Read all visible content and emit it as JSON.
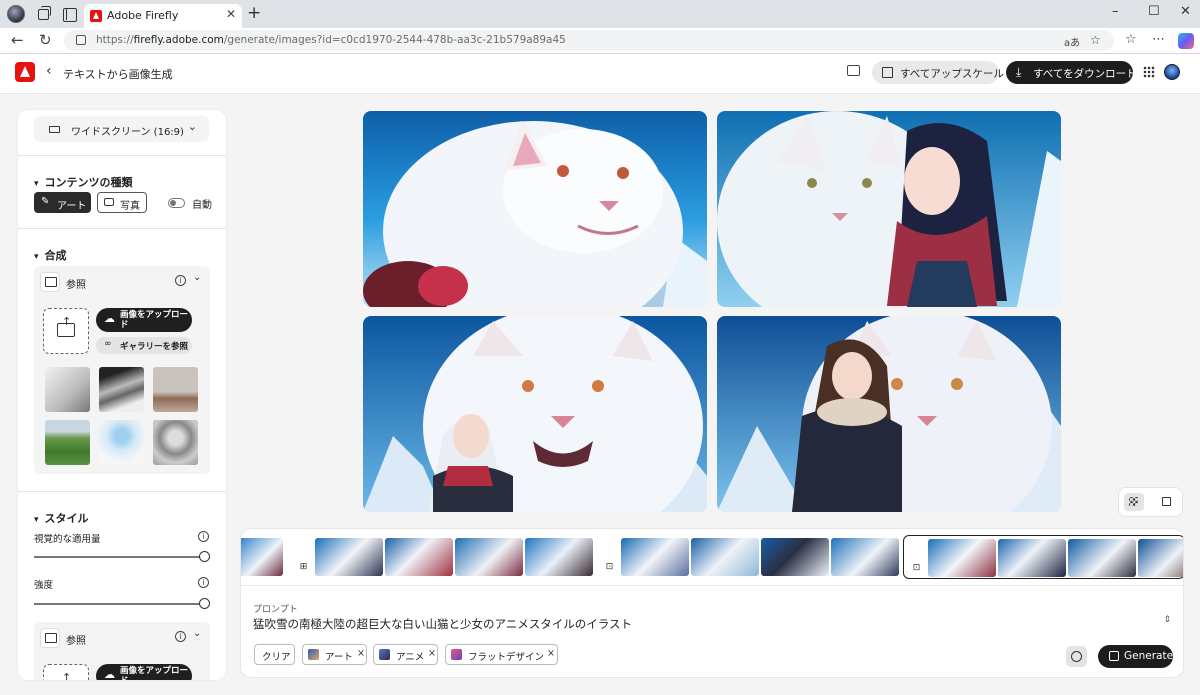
{
  "browser": {
    "tab_title": "Adobe Firefly",
    "tab_close": "✕",
    "new_tab": "+",
    "url_prefix": "https://",
    "url_host": "firefly.adobe.com",
    "url_path": "/generate/images?id=c0cd1970-2544-478b-aa3c-21b579a89a45",
    "read_aloud": "aあ",
    "window_controls": [
      "–",
      "☐",
      "✕"
    ]
  },
  "header": {
    "back": "‹",
    "title": "テキストから画像生成",
    "upscale_all": "すべてアップスケール",
    "download_all": "すべてをダウンロード"
  },
  "sidebar": {
    "aspect_ratio": "ワイドスクリーン (16:9)",
    "content_type": {
      "heading": "コンテンツの種類",
      "art": "アート",
      "photo": "写真",
      "auto": "自動"
    },
    "composition": {
      "heading": "合成",
      "reference": "参照",
      "upload_image": "画像をアップロード",
      "browse_gallery": "ギャラリーを参照",
      "thumbnails": [
        "bird-sketch",
        "mountain-road",
        "living-room",
        "green-field",
        "blue-sphere",
        "owl-sketch"
      ]
    },
    "style": {
      "heading": "スタイル",
      "visual_intensity": "視覚的な適用量",
      "visual_intensity_value": 1.0,
      "strength": "強度",
      "strength_value": 1.0,
      "reference": "参照",
      "upload_image": "画像をアップロード"
    }
  },
  "main": {
    "images": [
      "tiger-snow",
      "girl-and-white-cat",
      "tiger-roaring-girl",
      "girl-hugging-cat"
    ]
  },
  "prompt": {
    "label": "プロンプト",
    "text": "猛吹雪の南極大陸の超巨大な白い山猫と少女のアニメスタイルのイラスト",
    "clear": "クリア",
    "chips": [
      "アート",
      "アニメ",
      "フラットデザイン"
    ],
    "generate": "Generate"
  },
  "colors": {
    "adobe_red": "#e8110f",
    "sky_blue": "#1e88c8",
    "dark_button": "#1d1d1d"
  }
}
